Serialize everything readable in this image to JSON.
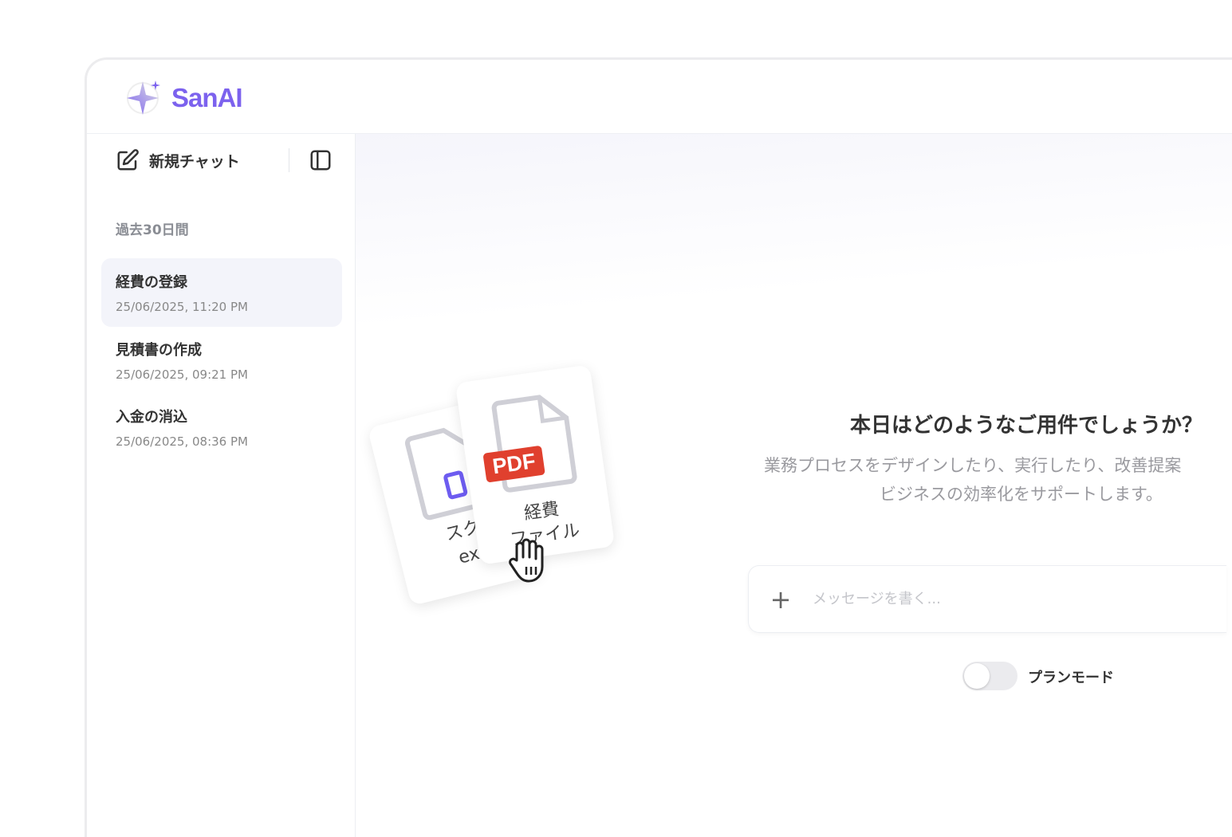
{
  "app": {
    "name": "SanAI",
    "brand_color": "#7c62ee"
  },
  "sidebar": {
    "new_chat_label": "新規チャット",
    "section_label": "過去30日間",
    "items": [
      {
        "title": "経費の登録",
        "date": "25/06/2025, 11:20 PM",
        "active": true
      },
      {
        "title": "見積書の作成",
        "date": "25/06/2025, 09:21 PM",
        "active": false
      },
      {
        "title": "入金の消込",
        "date": "25/06/2025, 08:36 PM",
        "active": false
      }
    ]
  },
  "main": {
    "heading": "本日はどのようなご用件でしょうか？",
    "subtitle_line1": "業務プロセスをデザインしたり、実行したり、改善提案",
    "subtitle_line2": "ビジネスの効率化をサポートします。",
    "input_placeholder": "メッセージを書く...",
    "plan_mode_label": "プランモード",
    "plan_mode_on": false
  },
  "illustration": {
    "back_card_label_line1": "スク",
    "back_card_label_line2": "ex",
    "front_card_badge": "PDF",
    "front_card_label_line1": "経費",
    "front_card_label_line2": "ファイル",
    "pdf_color": "#e0402e"
  }
}
